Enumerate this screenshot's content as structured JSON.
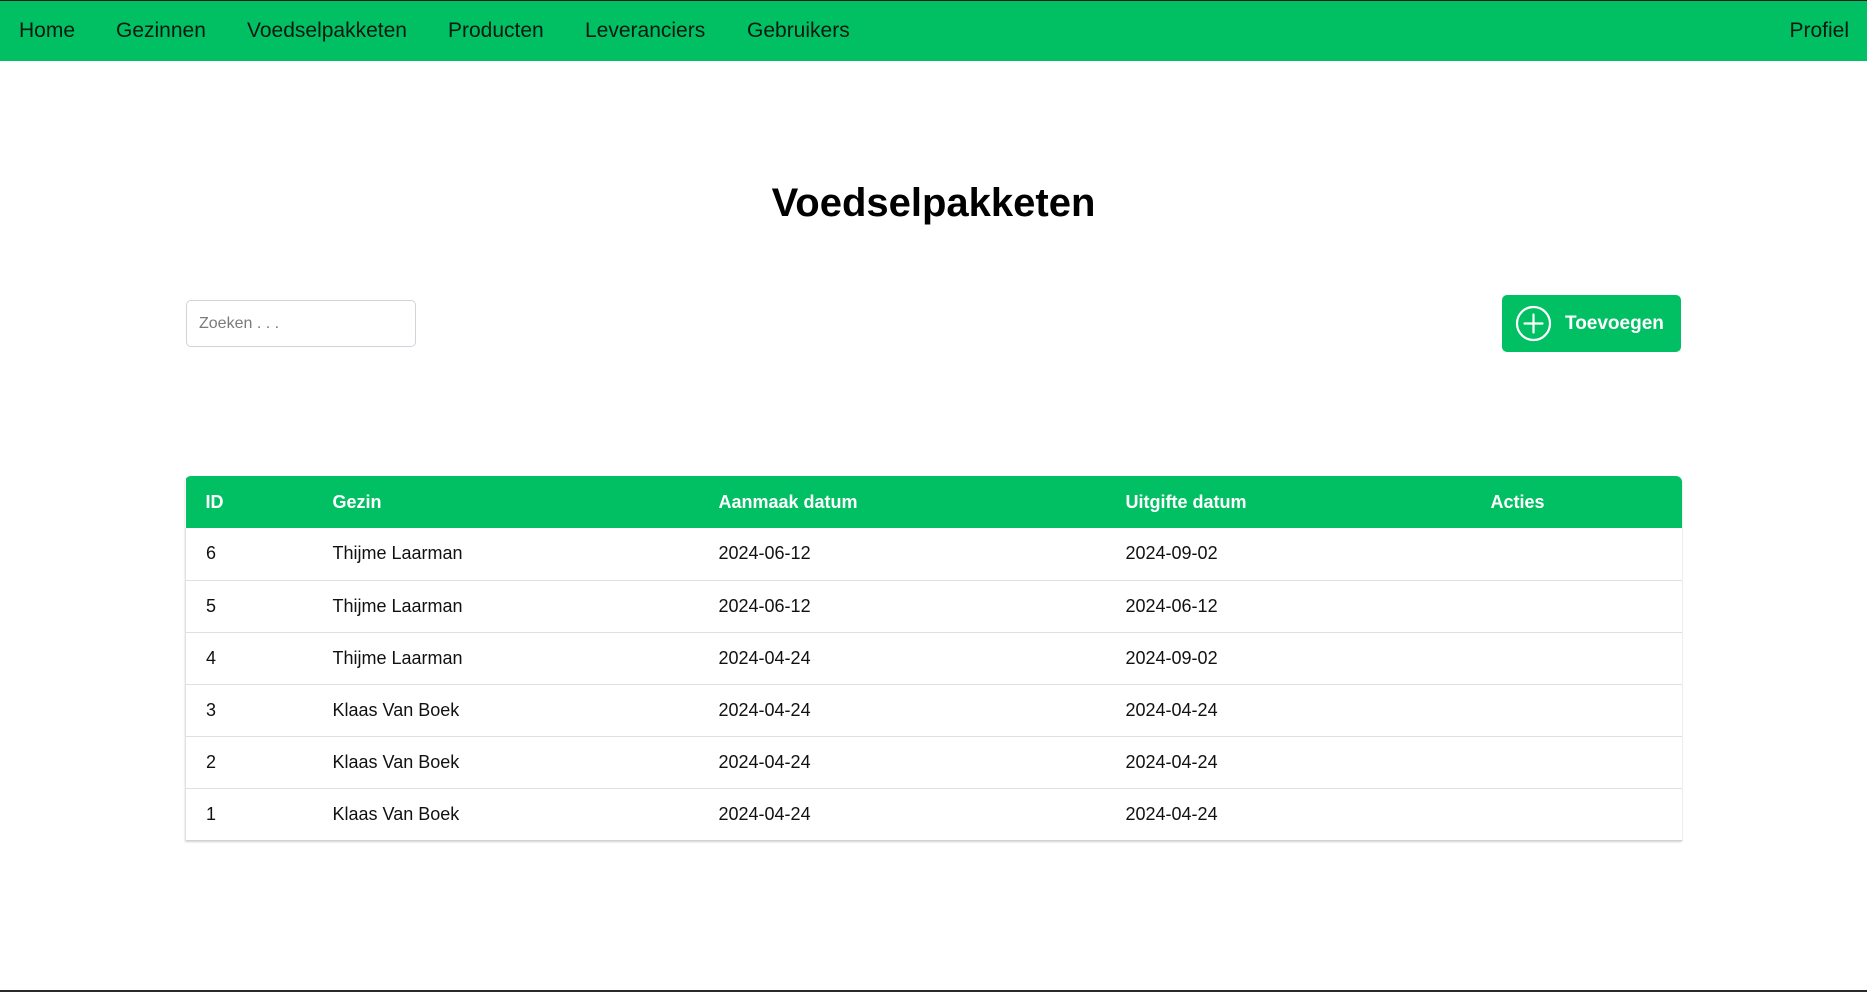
{
  "navbar": {
    "items": [
      {
        "id": "home",
        "label": "Home"
      },
      {
        "id": "gezinnen",
        "label": "Gezinnen"
      },
      {
        "id": "voedselpakketen",
        "label": "Voedselpakketen"
      },
      {
        "id": "producten",
        "label": "Producten"
      },
      {
        "id": "leveranciers",
        "label": "Leveranciers"
      },
      {
        "id": "gebruikers",
        "label": "Gebruikers"
      }
    ],
    "profile_label": "Profiel"
  },
  "main": {
    "title": "Voedselpakketen",
    "search": {
      "placeholder": "Zoeken . . .",
      "value": ""
    },
    "add_button": {
      "label": "Toevoegen",
      "icon": "plus-circle-icon"
    }
  },
  "table": {
    "columns": [
      "ID",
      "Gezin",
      "Aanmaak datum",
      "Uitgifte datum",
      "Acties"
    ],
    "rows": [
      {
        "id": "6",
        "gezin": "Thijme Laarman",
        "aanmaak": "2024-06-12",
        "uitgifte": "2024-09-02",
        "acties": ""
      },
      {
        "id": "5",
        "gezin": "Thijme Laarman",
        "aanmaak": "2024-06-12",
        "uitgifte": "2024-06-12",
        "acties": ""
      },
      {
        "id": "4",
        "gezin": "Thijme Laarman",
        "aanmaak": "2024-04-24",
        "uitgifte": "2024-09-02",
        "acties": ""
      },
      {
        "id": "3",
        "gezin": "Klaas Van Boek",
        "aanmaak": "2024-04-24",
        "uitgifte": "2024-04-24",
        "acties": ""
      },
      {
        "id": "2",
        "gezin": "Klaas Van Boek",
        "aanmaak": "2024-04-24",
        "uitgifte": "2024-04-24",
        "acties": ""
      },
      {
        "id": "1",
        "gezin": "Klaas Van Boek",
        "aanmaak": "2024-04-24",
        "uitgifte": "2024-04-24",
        "acties": ""
      }
    ]
  },
  "colors": {
    "accent": "#00c063",
    "header_text": "#ffffff",
    "body_text": "#111111"
  }
}
